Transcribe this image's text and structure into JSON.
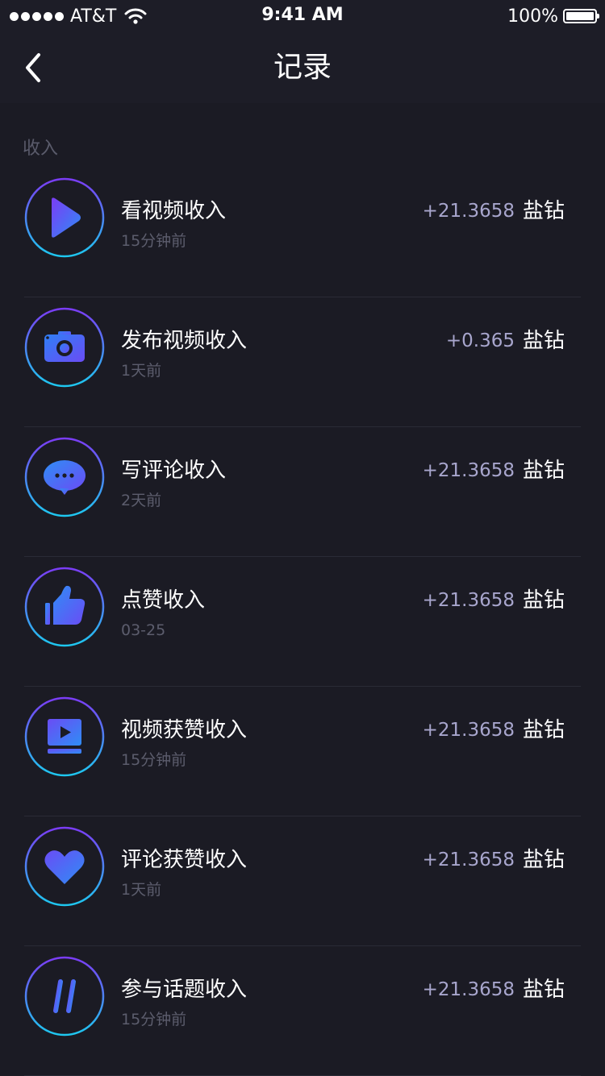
{
  "status_bar": {
    "carrier": "AT&T",
    "time": "9:41 AM",
    "battery": "100%"
  },
  "nav": {
    "title": "记录"
  },
  "section": {
    "label": "收入"
  },
  "records": [
    {
      "icon": "play-icon",
      "title": "看视频收入",
      "time": "15分钟前",
      "amount": "+21.3658",
      "unit": "盐钻"
    },
    {
      "icon": "camera-icon",
      "title": "发布视频收入",
      "time": "1天前",
      "amount": "+0.365",
      "unit": "盐钻"
    },
    {
      "icon": "chat-bubble-icon",
      "title": "写评论收入",
      "time": "2天前",
      "amount": "+21.3658",
      "unit": "盐钻"
    },
    {
      "icon": "thumbs-up-icon",
      "title": "点赞收入",
      "time": "03-25",
      "amount": "+21.3658",
      "unit": "盐钻"
    },
    {
      "icon": "video-player-icon",
      "title": "视频获赞收入",
      "time": "15分钟前",
      "amount": "+21.3658",
      "unit": "盐钻"
    },
    {
      "icon": "heart-icon",
      "title": "评论获赞收入",
      "time": "1天前",
      "amount": "+21.3658",
      "unit": "盐钻"
    },
    {
      "icon": "hashtag-icon",
      "title": "参与话题收入",
      "time": "15分钟前",
      "amount": "+21.3658",
      "unit": "盐钻"
    }
  ],
  "colors": {
    "background": "#1b1b24",
    "gradient_start": "#7b3cf5",
    "gradient_end": "#1ec8f0",
    "amount": "#a8a6cd",
    "muted": "#5c5d6d"
  }
}
